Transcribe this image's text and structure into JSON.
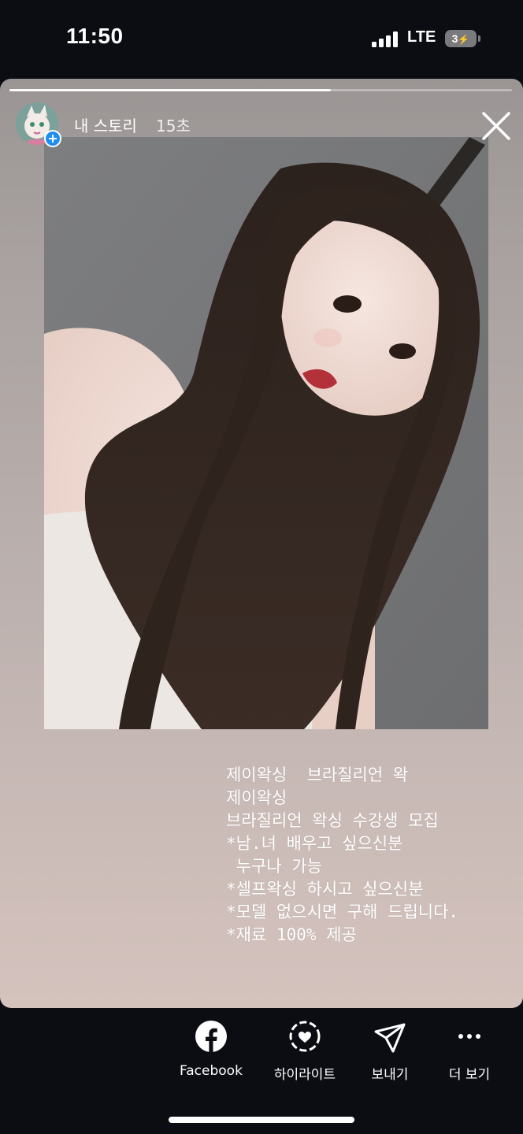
{
  "status_bar": {
    "time": "11:50",
    "network": "LTE",
    "battery": "3"
  },
  "story": {
    "username": "내 스토리",
    "time_ago": "15초",
    "progress": 0.64,
    "caption_lines": [
      "제이왁싱  브라질리언 왁",
      "제이왁싱",
      "브라질리언 왁싱 수강생 모집",
      "*남.녀 배우고 싶으신분",
      " 누구나 가능",
      "*셀프왁싱 하시고 싶으신분",
      "*모델 없으시면 구해 드립니다.",
      "*재료 100% 제공"
    ]
  },
  "actions": {
    "facebook": "Facebook",
    "highlight": "하이라이트",
    "send": "보내기",
    "more": "더 보기"
  },
  "colors": {
    "accent": "#1f8ef1",
    "background": "#0b0d12"
  },
  "icons": [
    "signal-icon",
    "battery-icon",
    "plus-icon",
    "close-icon",
    "facebook-icon",
    "highlight-icon",
    "send-icon",
    "more-icon"
  ]
}
